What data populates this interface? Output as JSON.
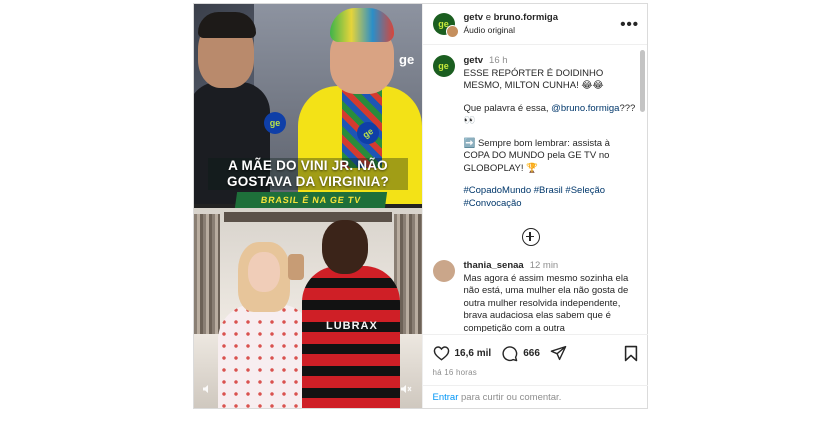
{
  "post": {
    "header": {
      "account": "getv",
      "separator": "e",
      "collaborator": "bruno.formiga",
      "audio": "Áudio original",
      "more_icon": "more-horizontal-icon"
    },
    "media": {
      "headline": "A MÃE DO VINI JR. NÃO GOSTAVA DA VIRGINIA?",
      "ribbon": "BRASIL É NA GE TV",
      "mic_label": "ge",
      "corner_mark": "ge",
      "jersey_text": "LUBRAX",
      "controls": [
        "audio-icon",
        "mute-icon"
      ]
    },
    "caption": {
      "user": "getv",
      "time": "16 h",
      "line1": "ESSE REPÓRTER É DOIDINHO MESMO, MILTON CUNHA! 😂😂",
      "line2_prefix": "Que palavra é essa,",
      "line2_mention": "@bruno.formiga",
      "line2_suffix": "??? 👀",
      "line3": "➡️ Sempre bom lembrar: assista à COPA DO MUNDO pela GE TV no GLOBOPLAY! 🏆",
      "hashtags": "#CopadoMundo #Brasil #Seleção #Convocação"
    },
    "comments": [
      {
        "user": "thania_senaa",
        "time": "12 min",
        "text": "Mas agora é assim mesmo sozinha ela não está, uma mulher ela não gosta de outra mulher resolvida independente, brava audaciosa elas sabem que é competição com a outra"
      }
    ],
    "actions": {
      "likes": "16,6 mil",
      "comments": "666",
      "time_ago": "há 16 horas"
    },
    "comment_input": {
      "cta": "Entrar",
      "rest": " para curtir ou comentar."
    }
  }
}
